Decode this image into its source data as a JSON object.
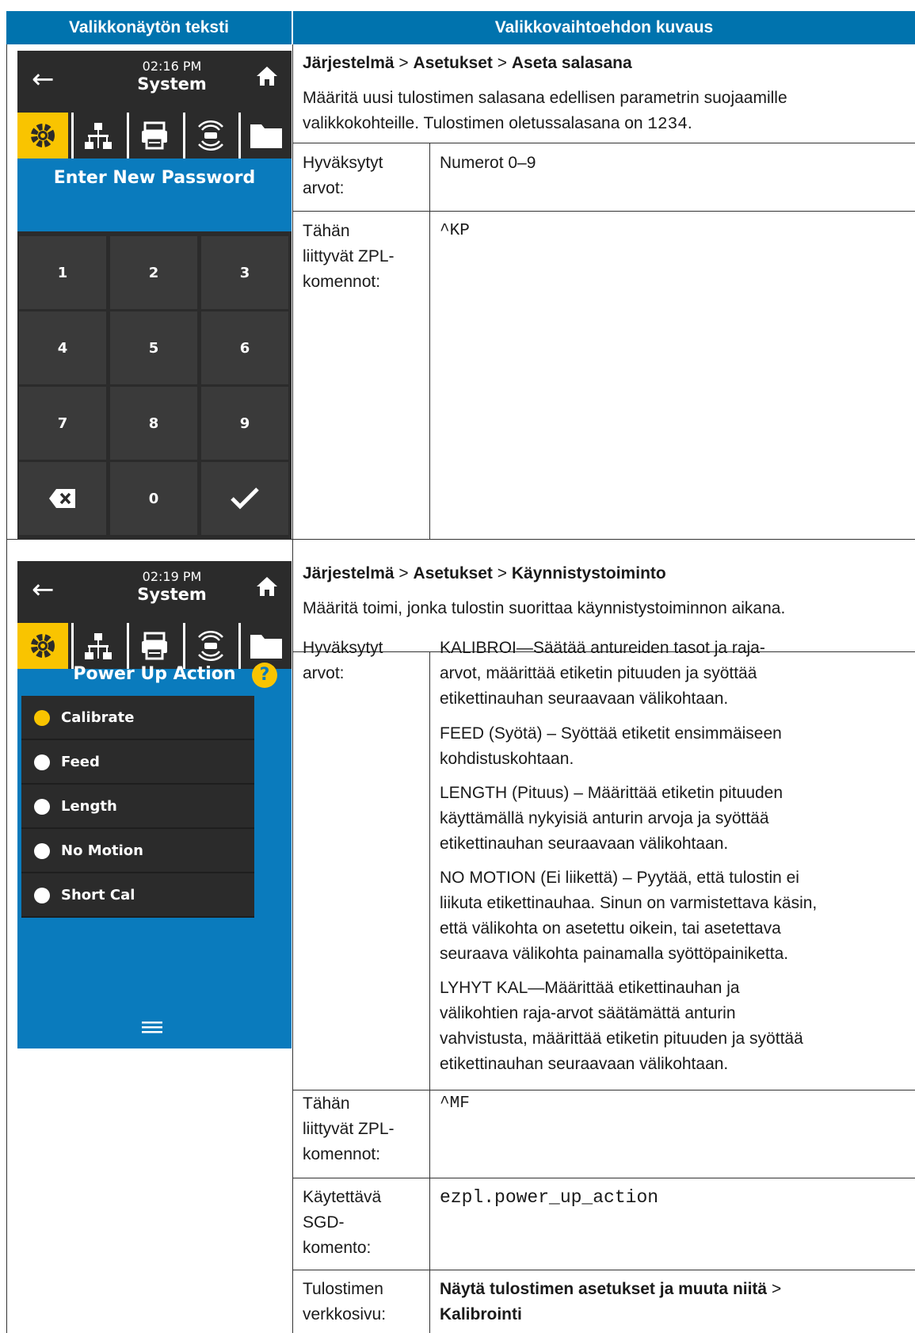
{
  "headers": {
    "left": "Valikkonäytön teksti",
    "right": "Valikkovaihtoehdon kuvaus"
  },
  "section1": {
    "screen": {
      "time": "02:16 PM",
      "title": "System",
      "heading": "Enter New Password",
      "keys": [
        "1",
        "2",
        "3",
        "4",
        "5",
        "6",
        "7",
        "8",
        "9",
        "0"
      ]
    },
    "path": {
      "part1": "Järjestelmä",
      "sep1": " > ",
      "part2": "Asetukset",
      "sep2": " > ",
      "part3": "Aseta salasana"
    },
    "desc_line1": "Määritä uusi tulostimen salasana edellisen parametrin suojaamille",
    "desc_line2": "valikkokohteille. Tulostimen oletussalasana on ",
    "desc_code": "1234",
    "desc_end": ".",
    "rows": [
      {
        "label": [
          "Hyväksytyt",
          "arvot:"
        ],
        "value": "Numerot 0–9"
      },
      {
        "label": [
          "Tähän",
          "liittyvät ZPL-",
          "komennot:"
        ],
        "value": "^KP"
      }
    ]
  },
  "section2": {
    "screen": {
      "time": "02:19 PM",
      "title": "System",
      "heading": "Power Up Action",
      "help": "?",
      "options": [
        "Calibrate",
        "Feed",
        "Length",
        "No Motion",
        "Short Cal"
      ],
      "selected": "Calibrate"
    },
    "path": {
      "part1": "Järjestelmä",
      "sep1": " > ",
      "part2": "Asetukset",
      "sep2": " > ",
      "part3": "Käynnistystoiminto"
    },
    "desc": "Määritä toimi, jonka tulostin suorittaa käynnistystoiminnon aikana.",
    "accepted_label": [
      "Hyväksytyt",
      "arvot:"
    ],
    "accepted_values": [
      [
        "KALIBROI—Säätää antureiden tasot ja raja-",
        "arvot, määrittää etiketin pituuden ja syöttää",
        "etikettinauhan seuraavaan välikohtaan."
      ],
      [
        "FEED (Syötä) – Syöttää etiketit ensimmäiseen",
        "kohdistuskohtaan."
      ],
      [
        "LENGTH (Pituus) – Määrittää etiketin pituuden",
        "käyttämällä nykyisiä anturin arvoja ja syöttää",
        "etikettinauhan seuraavaan välikohtaan."
      ],
      [
        "NO MOTION (Ei liikettä) – Pyytää, että tulostin ei",
        "liikuta etikettinauhaa. Sinun on varmistettava käsin,",
        "että välikohta on asetettu oikein, tai asetettava",
        "seuraava välikohta painamalla syöttöpainiketta."
      ],
      [
        "LYHYT KAL—Määrittää etikettinauhan ja",
        "välikohtien raja-arvot säätämättä anturin",
        "vahvistusta, määrittää etiketin pituuden ja syöttää",
        "etikettinauhan seuraavaan välikohtaan."
      ]
    ],
    "zpl_label": [
      "Tähän",
      "liittyvät ZPL-",
      "komennot:"
    ],
    "zpl_value": "^MF",
    "sgd_label": [
      "Käytettävä",
      "SGD-",
      "komento:"
    ],
    "sgd_value": "ezpl.power_up_action",
    "web_label": [
      "Tulostimen",
      "verkkosivu:"
    ],
    "web_value1": "Näytä tulostimen asetukset ja muuta niitä",
    "web_sep": " > ",
    "web_value2": "Kalibrointi"
  },
  "icons": [
    "back-arrow-icon",
    "home-icon",
    "gear-icon",
    "network-icon",
    "printer-icon",
    "wireless-icon",
    "folder-icon",
    "backspace-icon",
    "checkmark-icon",
    "help-icon",
    "menu-icon"
  ],
  "colors": {
    "header_blue": "#0073ae",
    "screen_blue": "#0a7bbd",
    "dark": "#2b2b2b",
    "accent_yellow": "#f9c400"
  }
}
